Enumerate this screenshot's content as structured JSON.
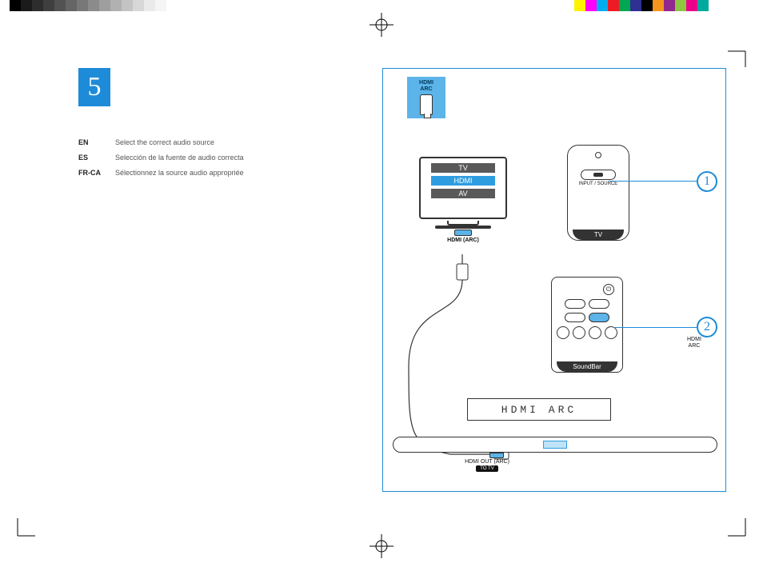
{
  "step_number": "5",
  "langs": [
    {
      "code": "EN",
      "text": "Select the correct audio source"
    },
    {
      "code": "ES",
      "text": "Selección de la fuente de audio correcta"
    },
    {
      "code": "FR-CA",
      "text": "Sélectionnez la source audio appropriée"
    }
  ],
  "key": {
    "label_line1": "HDMI",
    "label_line2": "ARC"
  },
  "tv_menu": {
    "item1": "TV",
    "item2": "HDMI",
    "item3": "AV"
  },
  "tv_port_label": "HDMI (ARC)",
  "remote1": {
    "button_label": "INPUT / SOURCE",
    "footer": "TV"
  },
  "remote2": {
    "footer": "SoundBar"
  },
  "callouts": {
    "one": "1",
    "two": "2"
  },
  "callout2_label": {
    "l1": "HDMI",
    "l2": "ARC"
  },
  "display_text": "HDMI  ARC",
  "soundbar_port": {
    "line1": "HDMI OUT (ARC)",
    "line2": "TO TV"
  },
  "color_bars_left": [
    "#000000",
    "#1a1a1a",
    "#2d2d2d",
    "#3f3f3f",
    "#525252",
    "#656565",
    "#787878",
    "#8b8b8b",
    "#9e9e9e",
    "#b1b1b1",
    "#c4c4c4",
    "#d7d7d7",
    "#eaeaea",
    "#f5f5f5",
    "#ffffff",
    "#ffffff",
    "#ffffff",
    "#ffffff"
  ],
  "color_bars_right": [
    "#ffffff",
    "#ffffff",
    "#fff200",
    "#ff00ff",
    "#00aeef",
    "#ed1c24",
    "#00a651",
    "#2e3192",
    "#000000",
    "#f7941d",
    "#92278f",
    "#8dc63f",
    "#ec008c",
    "#00a99d",
    "#ffffff",
    "#ffffff",
    "#ffffff",
    "#ffffff"
  ]
}
